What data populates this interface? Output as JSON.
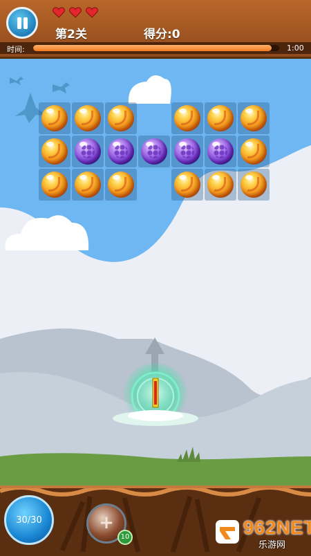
{
  "header": {
    "level": "第2关",
    "score": "得分:0",
    "lives": 3,
    "time_label": "时间:",
    "time_value": "1:00",
    "time_progress": 0.97
  },
  "board": {
    "rows": [
      [
        "orange",
        "orange",
        "orange",
        null,
        "orange",
        "orange",
        "orange"
      ],
      [
        "orange",
        "purple",
        "purple",
        "purple",
        "purple",
        "purple",
        "orange"
      ],
      [
        "orange",
        "orange",
        "orange",
        null,
        "orange",
        "orange",
        "orange"
      ]
    ]
  },
  "bottom": {
    "ammo": "30/30",
    "powerup_count": "10",
    "powerup_icon": "plus-icon"
  },
  "watermark": {
    "main": "962NET",
    "sub": "乐游网"
  },
  "colors": {
    "sky": "#6fb7f2",
    "wood": "#a3582a",
    "grass": "#6a9c43",
    "accent": "#f18a1e"
  }
}
